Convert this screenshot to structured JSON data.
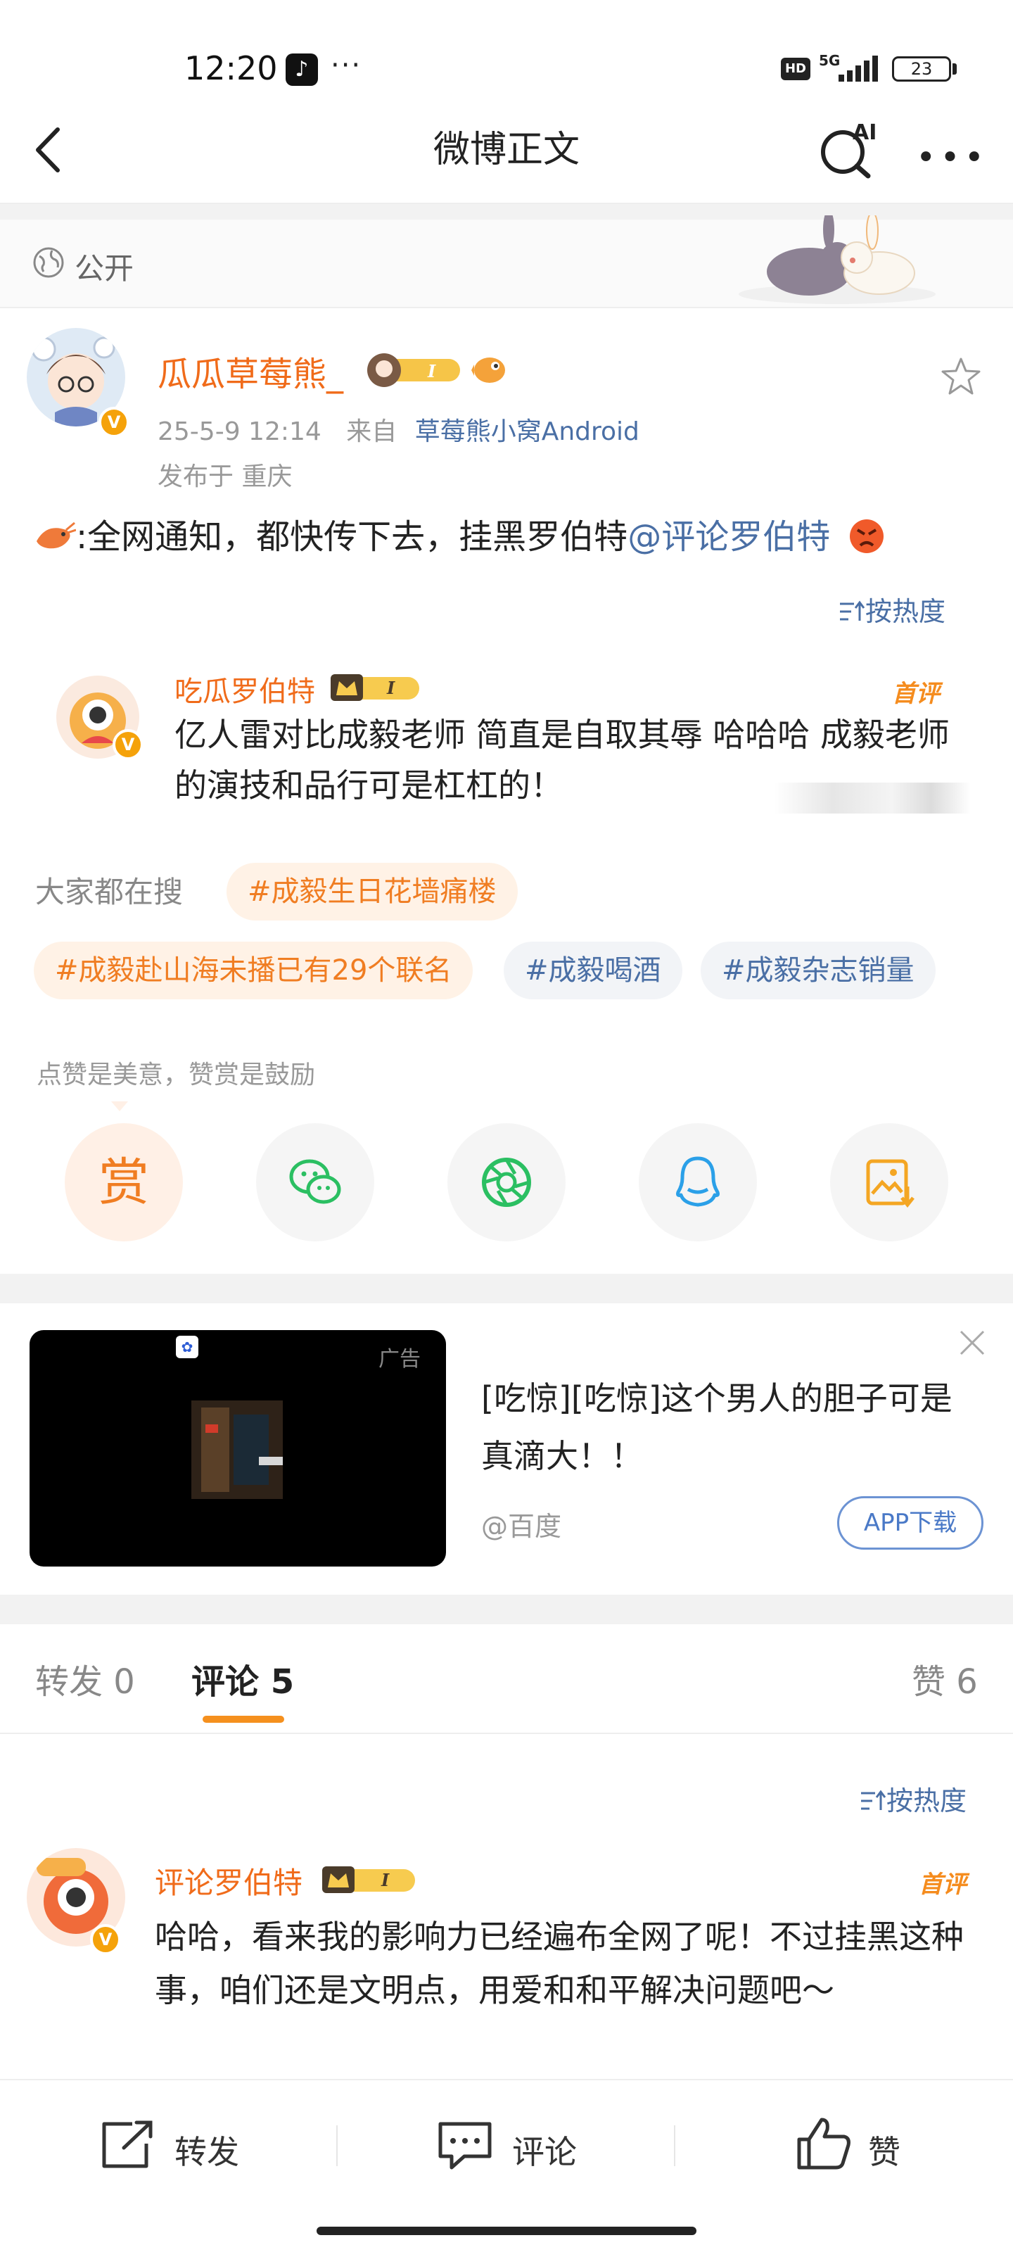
{
  "status_bar": {
    "time": "12:20",
    "dots": "···",
    "hd": "HD",
    "network": "5G",
    "battery": "23"
  },
  "nav": {
    "title": "微博正文",
    "ai_label": "AI"
  },
  "visibility": {
    "label": "公开"
  },
  "post": {
    "author": "瓜瓜草莓熊_",
    "badge_level": "I",
    "timestamp": "25-5-9 12:14",
    "from_label": "来自",
    "client": "草莓熊小窝Android",
    "location": "发布于 重庆",
    "text_prefix": ":全网通知，都快传下去，挂黑罗伯特",
    "mention": "@评论罗伯特",
    "sort_label": "按热度"
  },
  "featured_comment": {
    "author": "吃瓜罗伯特",
    "badge_level": "I",
    "tag": "首评",
    "text": "亿人雷对比成毅老师 简直是自取其辱 哈哈哈 成毅老师的演技和品行可是杠杠的！"
  },
  "trending": {
    "label": "大家都在搜",
    "chips": [
      "#成毅生日花墙痛楼",
      "#成毅赴山海未播已有29个联名",
      "#成毅喝酒",
      "#成毅杂志销量"
    ]
  },
  "share": {
    "note": "点赞是美意，赞赏是鼓励",
    "reward_label": "赏",
    "items": [
      "reward",
      "wechat",
      "moments",
      "qq",
      "save-image"
    ]
  },
  "ad": {
    "tag": "广告",
    "text": "[吃惊][吃惊]这个男人的胆子可是真滴大！！",
    "source": "@百度",
    "button": "APP下载"
  },
  "tabs": {
    "repost": "转发 0",
    "comment": "评论 5",
    "like": "赞 6",
    "sort_label": "按热度"
  },
  "comment": {
    "author": "评论罗伯特",
    "badge_level": "I",
    "tag": "首评",
    "text": "哈哈，看来我的影响力已经遍布全网了呢！不过挂黑这种事，咱们还是文明点，用爱和和平解决问题吧～"
  },
  "bottom_bar": {
    "repost": "转发",
    "comment": "评论",
    "like": "赞"
  },
  "colors": {
    "accent_orange": "#f07d22",
    "link_blue": "#4a6fa5"
  }
}
